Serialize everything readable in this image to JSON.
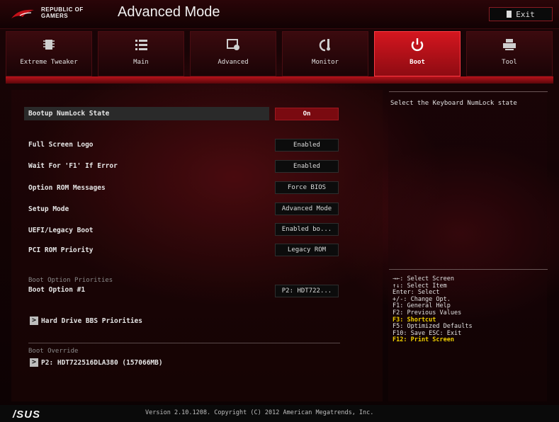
{
  "header": {
    "brand_line1": "REPUBLIC OF",
    "brand_line2": "GAMERS",
    "mode_title": "Advanced Mode",
    "exit_label": "Exit"
  },
  "tabs": [
    {
      "label": "Extreme Tweaker",
      "icon": "chip-icon"
    },
    {
      "label": "Main",
      "icon": "list-icon"
    },
    {
      "label": "Advanced",
      "icon": "advanced-icon"
    },
    {
      "label": "Monitor",
      "icon": "monitor-icon"
    },
    {
      "label": "Boot",
      "icon": "power-icon",
      "active": true
    },
    {
      "label": "Tool",
      "icon": "printer-icon"
    }
  ],
  "settings": [
    {
      "label": "Bootup NumLock State",
      "value": "On",
      "active": true
    },
    {
      "label": "Full Screen Logo",
      "value": "Enabled"
    },
    {
      "label": "Wait For 'F1' If Error",
      "value": "Enabled"
    },
    {
      "label": "Option ROM Messages",
      "value": "Force BIOS"
    },
    {
      "label": "Setup Mode",
      "value": "Advanced Mode"
    },
    {
      "label": "UEFI/Legacy Boot",
      "value": "Enabled bo..."
    },
    {
      "label": "PCI ROM Priority",
      "value": "Legacy ROM"
    }
  ],
  "boot_priorities": {
    "heading": "Boot Option Priorities",
    "option1_label": "Boot Option #1",
    "option1_value": "P2: HDT722...",
    "hdd_bbs_label": "Hard Drive BBS Priorities"
  },
  "boot_override": {
    "heading": "Boot Override",
    "item": "P2: HDT722516DLA380  (157066MB)"
  },
  "help": {
    "description": "Select the Keyboard NumLock state"
  },
  "keys": [
    {
      "text": "→←: Select Screen"
    },
    {
      "text": "↑↓: Select Item"
    },
    {
      "text": "Enter: Select"
    },
    {
      "text": "+/-: Change Opt."
    },
    {
      "text": "F1: General Help"
    },
    {
      "text": "F2: Previous Values"
    },
    {
      "text": "F3: Shortcut",
      "highlight": true
    },
    {
      "text": "F5: Optimized Defaults"
    },
    {
      "text": "F10: Save  ESC: Exit"
    },
    {
      "text": "F12: Print Screen",
      "highlight": true
    }
  ],
  "footer": {
    "logo": "/SUS",
    "version": "Version 2.10.1208. Copyright (C) 2012 American Megatrends, Inc."
  },
  "colors": {
    "accent_red": "#d4161f",
    "highlight_yellow": "#f0d000"
  }
}
